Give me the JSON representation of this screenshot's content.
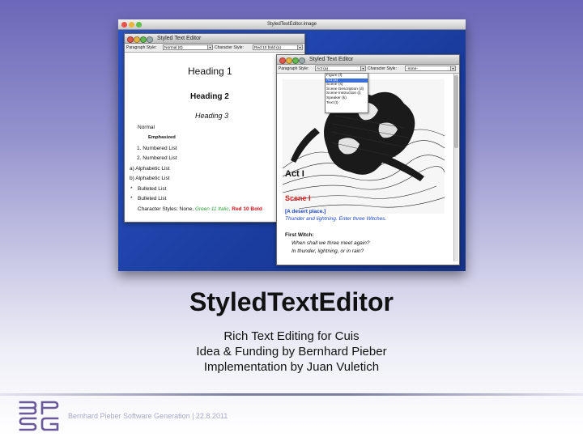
{
  "screenshot": {
    "outer_window_title": "StyledTextEditor.image",
    "editor_window_title": "Styled Text Editor",
    "left_editor": {
      "paragraph_style_label": "Paragraph Style:",
      "paragraph_style_value": "Normal (0)",
      "character_style_label": "Character Style:",
      "character_style_value": "Red 10 bold (o)",
      "content": {
        "heading1": "Heading 1",
        "heading2": "Heading 2",
        "heading3": "Heading 3",
        "normal": "Normal",
        "emphasized": "Emphasized",
        "numbered1": "1.  Numbered List",
        "numbered2": "2.  Numbered List",
        "alpha1": "a)  Alphabetic List",
        "alpha2": "b)  Alphabetic List",
        "bullet_marker": "*",
        "bullet1": "Bulleted List",
        "bullet2": "Bulleted List",
        "charstyles_prefix": "Character Styles: None,",
        "charstyles_green": "Green 11 Italic,",
        "charstyles_red": "Red 10 Bold"
      }
    },
    "right_editor": {
      "paragraph_style_label": "Paragraph Style:",
      "paragraph_style_value": "Act (a)",
      "character_style_label": "Character Style:",
      "character_style_value": "-none-",
      "dropdown_options": [
        "Figure (f)",
        "Act (a)",
        "Scene (s)",
        "Scene Description (d)",
        "Scene Instruction (i)",
        "Speaker (k)",
        "Text (t)"
      ],
      "dropdown_selected_index": 1,
      "image_description": "engraving-of-three-witches",
      "content": {
        "act": "Act I",
        "scene": "Scene I",
        "scene_description": "[A desert place.]",
        "scene_instruction": "Thunder and lightning. Enter three Witches.",
        "speaker": "First Witch:",
        "line1": "When shall we three meet again?",
        "line2": "In thunder, lightning, or in rain?"
      }
    }
  },
  "slide": {
    "title": "StyledTextEditor",
    "subtitle_lines": [
      "Rich Text Editing for Cuis",
      "Idea & Funding by Bernhard Pieber",
      "Implementation by Juan Vuletich"
    ],
    "footer": "Bernhard Pieber Software Generation  |  22.8.2011",
    "logo_letters": [
      "B",
      "P",
      "S",
      "G"
    ]
  },
  "colors": {
    "desktop_blue": "#1c3fa8",
    "heading_red": "#d41a1a",
    "description_blue": "#1c46c8",
    "green_italic": "#2ea33a",
    "logo_purple": "#6a5a9a"
  }
}
